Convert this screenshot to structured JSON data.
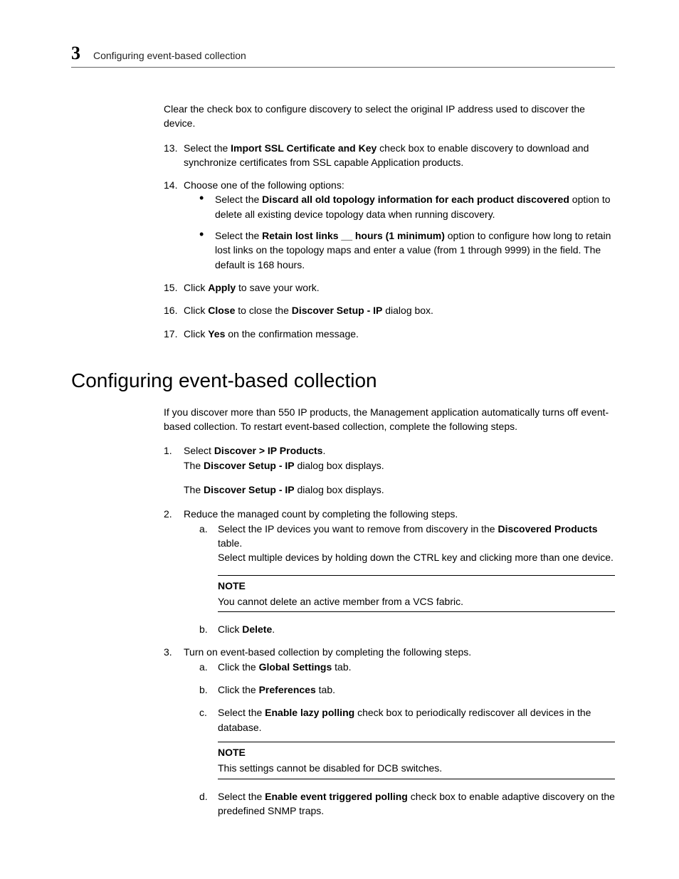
{
  "header": {
    "chapter_number": "3",
    "chapter_title": "Configuring event-based collection"
  },
  "top": {
    "p0": "Clear the check box to configure discovery to select the original IP address used to discover the device.",
    "s13": {
      "num": "13.",
      "t1": "Select the ",
      "b1": "Import SSL Certificate and Key",
      "t2": " check box to enable discovery to download and synchronize certificates from SSL capable Application products."
    },
    "s14": {
      "num": "14.",
      "t1": "Choose one of the following options:",
      "bul_a": {
        "t1": "Select the ",
        "b1": "Discard all old topology information for each product discovered",
        "t2": " option to delete all existing device topology data when running discovery."
      },
      "bul_b": {
        "t1": "Select the ",
        "b1": "Retain lost links __ hours (1 minimum)",
        "t2": " option to configure how long to retain lost links on the topology maps and enter a value (from 1 through 9999) in the field. The default is 168 hours."
      }
    },
    "s15": {
      "num": "15.",
      "t1": "Click ",
      "b1": "Apply",
      "t2": " to save your work."
    },
    "s16": {
      "num": "16.",
      "t1": "Click ",
      "b1": "Close",
      "t2": " to close the ",
      "b2": "Discover Setup - IP",
      "t3": " dialog box."
    },
    "s17": {
      "num": "17.",
      "t1": "Click ",
      "b1": "Yes",
      "t2": " on the confirmation message."
    }
  },
  "section": {
    "title": "Configuring event-based collection",
    "intro": "If you discover more than 550 IP products, the Management application automatically turns off event-based collection. To restart event-based collection, complete the following steps.",
    "s1": {
      "num": "1.",
      "t1": "Select ",
      "b1": "Discover > IP Products",
      "t2": ".",
      "p2a": "The ",
      "p2b": "Discover Setup - IP",
      "p2c": " dialog box displays.",
      "p3a": "The ",
      "p3b": "Discover Setup - IP",
      "p3c": " dialog box displays."
    },
    "s2": {
      "num": "2.",
      "t1": "Reduce the managed count by completing the following steps.",
      "a": {
        "m": "a.",
        "t1": "Select the IP devices you want to remove from discovery in the ",
        "b1": "Discovered Products",
        "t2": " table.",
        "sub": "Select multiple devices by holding down the CTRL key and clicking more than one device."
      },
      "note1": {
        "label": "NOTE",
        "text": "You cannot delete an active member from a VCS fabric."
      },
      "b": {
        "m": "b.",
        "t1": "Click ",
        "b1": "Delete",
        "t2": "."
      }
    },
    "s3": {
      "num": "3.",
      "t1": "Turn on event-based collection by completing the following steps.",
      "a": {
        "m": "a.",
        "t1": "Click the ",
        "b1": "Global Settings",
        "t2": " tab."
      },
      "b": {
        "m": "b.",
        "t1": "Click the ",
        "b1": "Preferences",
        "t2": " tab."
      },
      "c": {
        "m": "c.",
        "t1": "Select the ",
        "b1": "Enable lazy polling",
        "t2": " check box to periodically rediscover all devices in the database."
      },
      "note2": {
        "label": "NOTE",
        "text": "This settings cannot be disabled for DCB switches."
      },
      "d": {
        "m": "d.",
        "t1": "Select the ",
        "b1": "Enable event triggered polling",
        "t2": " check box to enable adaptive discovery on the predefined SNMP traps."
      }
    }
  }
}
